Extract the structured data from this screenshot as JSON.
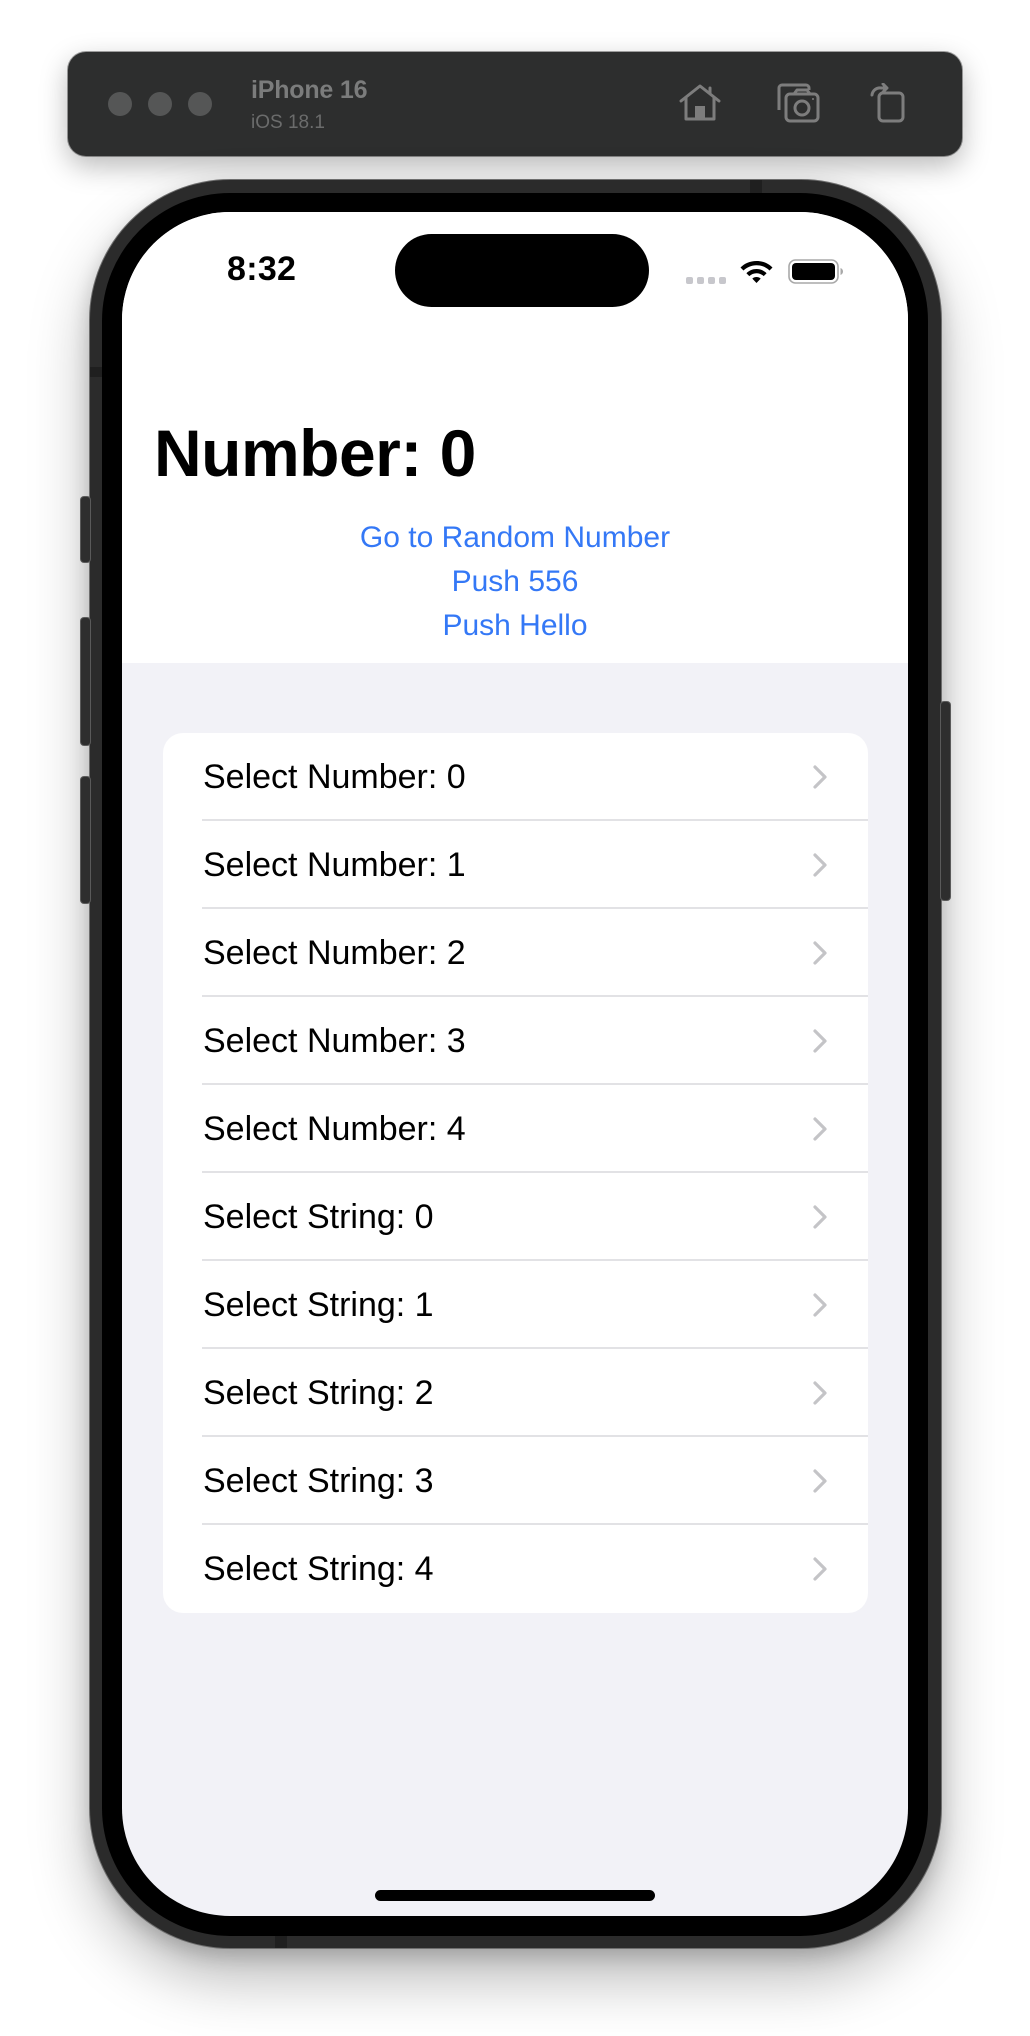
{
  "simulator": {
    "device_name": "iPhone 16",
    "os_version": "iOS 18.1",
    "toolbar_icons": [
      "home-icon",
      "screenshot-icon",
      "rotate-icon"
    ]
  },
  "status_bar": {
    "time": "8:32",
    "icons": [
      "cellular-signal-icon",
      "wifi-icon",
      "battery-icon"
    ]
  },
  "header": {
    "title": "Number: 0",
    "links": [
      {
        "label": "Go to Random Number"
      },
      {
        "label": "Push 556"
      },
      {
        "label": "Push Hello"
      }
    ]
  },
  "list": {
    "items": [
      {
        "label": "Select Number: 0"
      },
      {
        "label": "Select Number: 1"
      },
      {
        "label": "Select Number: 2"
      },
      {
        "label": "Select Number: 3"
      },
      {
        "label": "Select Number: 4"
      },
      {
        "label": "Select String: 0"
      },
      {
        "label": "Select String: 1"
      },
      {
        "label": "Select String: 2"
      },
      {
        "label": "Select String: 3"
      },
      {
        "label": "Select String: 4"
      }
    ],
    "accessory_icon": "chevron-right-icon"
  },
  "colors": {
    "accent": "#3478f6",
    "grouped_background": "#f2f2f7",
    "chevron": "#c4c4c7",
    "toolbar_background": "#2d2e2e"
  }
}
